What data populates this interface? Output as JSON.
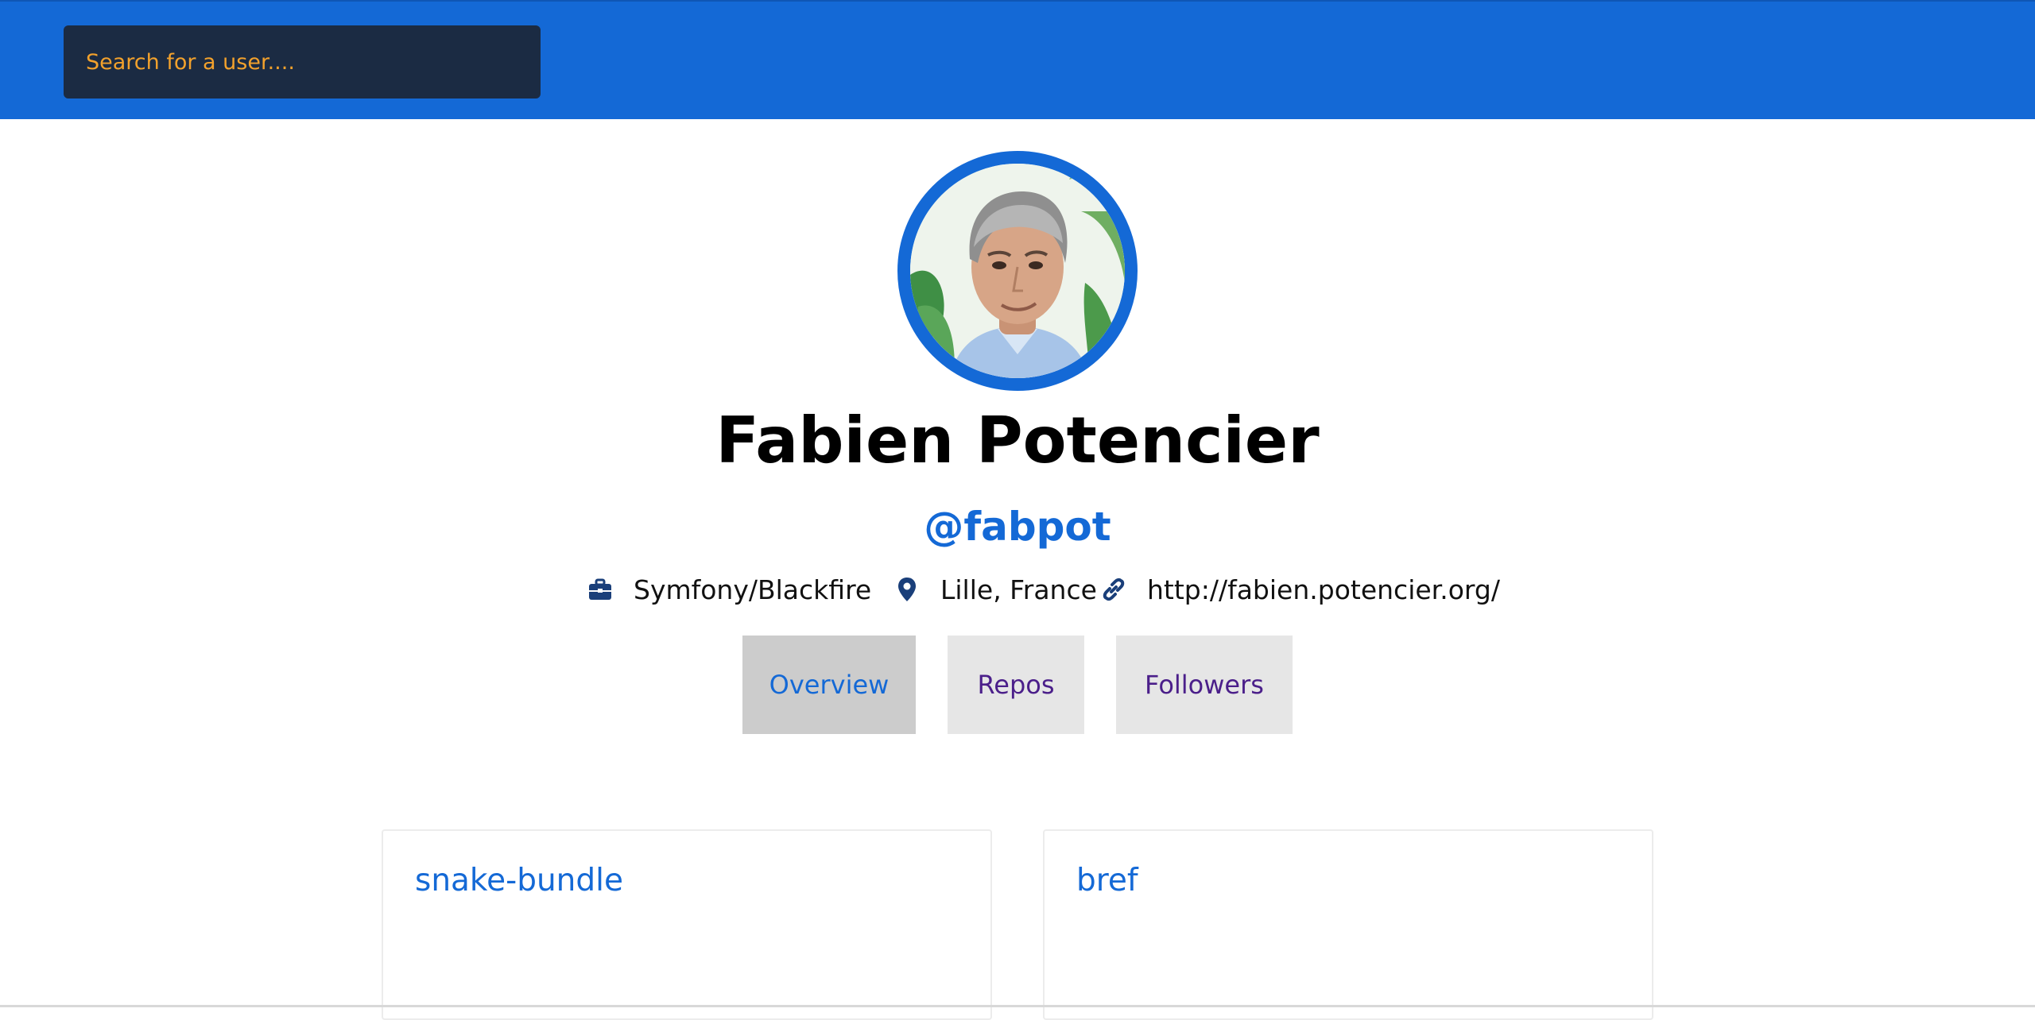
{
  "search": {
    "placeholder": "Search for a user...."
  },
  "profile": {
    "name": "Fabien Potencier",
    "handle": "@fabpot",
    "avatar_icon": "avatar-photo",
    "company": "Symfony/Blackfire",
    "location": "Lille, France",
    "website": "http://fabien.potencier.org/"
  },
  "tabs": [
    {
      "label": "Overview",
      "active": true
    },
    {
      "label": "Repos",
      "active": false
    },
    {
      "label": "Followers",
      "active": false
    }
  ],
  "repos": [
    {
      "name": "snake-bundle"
    },
    {
      "name": "bref"
    }
  ],
  "icons": {
    "company": "briefcase-icon",
    "location": "map-pin-icon",
    "website": "link-icon"
  },
  "colors": {
    "header": "#1469d6",
    "search_bg": "#1b2b43",
    "search_text": "#f5a623",
    "accent": "#1469d6",
    "tab_bg": "#e6e6e6",
    "tab_active_bg": "#cccccc",
    "tab_text": "#4b1f8a",
    "icon": "#1a3f7a"
  }
}
